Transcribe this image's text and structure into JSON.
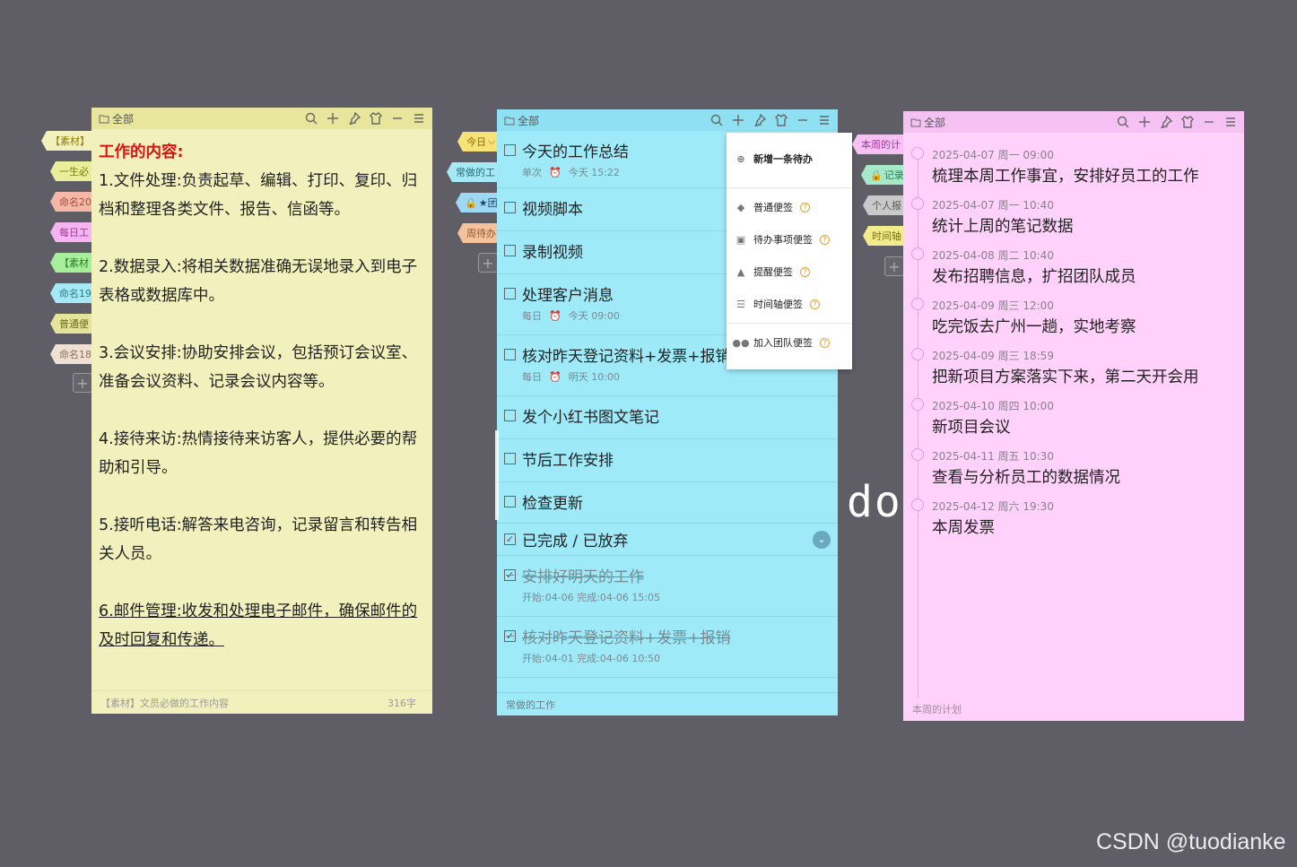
{
  "titlebar": {
    "folder": "全部"
  },
  "left_tabs": [
    "【素材】",
    "一生必",
    "命名20",
    "每日工",
    "【素材",
    "命名19",
    "普通便",
    "命名18"
  ],
  "yellow_note": {
    "heading": "工作的内容:",
    "paragraphs": [
      "1.文件处理:负责起草、编辑、打印、复印、归档和整理各类文件、报告、信函等。",
      "2.数据录入:将相关数据准确无误地录入到电子表格或数据库中。",
      "3.会议安排:协助安排会议，包括预订会议室、准备会议资料、记录会议内容等。",
      "4.接待来访:热情接待来访客人，提供必要的帮助和引导。",
      "5.接听电话:解答来电咨询，记录留言和转告相关人员。",
      "6.邮件管理:收发和处理电子邮件，确保邮件的及时回复和传递。"
    ],
    "footer_title": "【素材】文员必做的工作内容",
    "footer_count": "316字"
  },
  "middle_tabs": [
    "今日",
    "常做的工",
    "★团",
    "周待办"
  ],
  "todo": {
    "items": [
      {
        "text": "今天的工作总结",
        "repeat": "单次",
        "time": "今天 15:22"
      },
      {
        "text": "视频脚本"
      },
      {
        "text": "录制视频"
      },
      {
        "text": "处理客户消息",
        "repeat": "每日",
        "time": "今天 09:00"
      },
      {
        "text": "核对昨天登记资料+发票+报销",
        "repeat": "每日",
        "time": "明天 10:00"
      },
      {
        "text": "发个小红书图文笔记"
      },
      {
        "text": "节后工作安排"
      },
      {
        "text": "检查更新"
      }
    ],
    "done_header": "已完成 / 已放弃",
    "done_items": [
      {
        "text": "安排好明天的工作",
        "meta": "开始:04-06 完成:04-06 15:05"
      },
      {
        "text": "核对昨天登记资料+发票+报销",
        "meta": "开始:04-01 完成:04-06 10:50"
      }
    ],
    "footer_title": "常做的工作"
  },
  "menu": {
    "add_todo": "新增一条待办",
    "items": [
      "普通便签",
      "待办事项便签",
      "提醒便签",
      "时间轴便签"
    ],
    "team": "加入团队便签"
  },
  "right_tabs": [
    "本周的计",
    "记录",
    "个人报",
    "时间轴"
  ],
  "timeline": {
    "items": [
      {
        "date": "2025-04-07 周一 09:00",
        "text": "梳理本周工作事宜，安排好员工的工作"
      },
      {
        "date": "2025-04-07 周一 10:40",
        "text": "统计上周的笔记数据"
      },
      {
        "date": "2025-04-08 周二 10:40",
        "text": "发布招聘信息，扩招团队成员"
      },
      {
        "date": "2025-04-09 周三 12:00",
        "text": "吃完饭去广州一趟，实地考察"
      },
      {
        "date": "2025-04-09 周三 18:59",
        "text": "把新项目方案落实下来，第二天开会用"
      },
      {
        "date": "2025-04-10 周四 10:00",
        "text": "新项目会议"
      },
      {
        "date": "2025-04-11 周五 10:30",
        "text": "查看与分析员工的数据情况"
      },
      {
        "date": "2025-04-12 周六 19:30",
        "text": "本周发票"
      }
    ],
    "footer_title": "本周的计划"
  },
  "ghost_text": "do",
  "watermark": "CSDN @tuodianke"
}
